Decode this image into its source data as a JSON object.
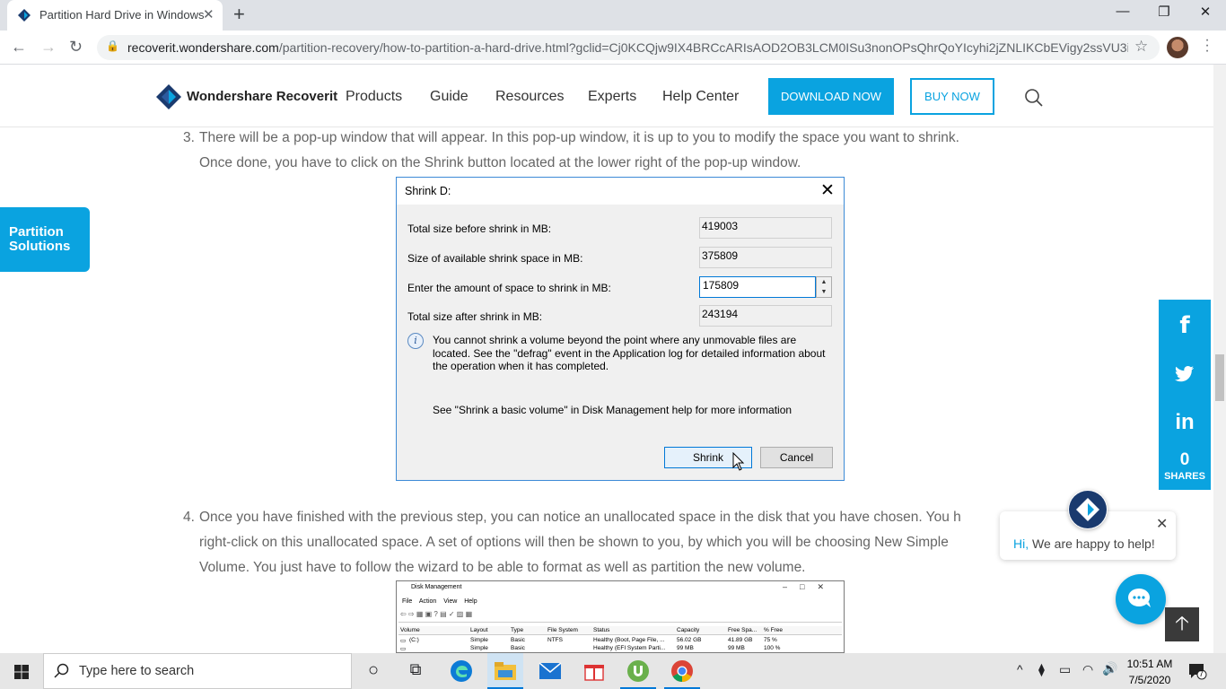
{
  "browser": {
    "tab_title": "Partition Hard Drive in Windows",
    "url_host": "recoverit.wondershare.com",
    "url_path": "/partition-recovery/how-to-partition-a-hard-drive.html?gclid=Cj0KCQjw9IX4BRCcARIsAOD2OB3LCM0ISu3nonOPsQhrQoYIcyhi2jZNLIKCbEVigy2ssVU3iI..."
  },
  "site": {
    "brand": "Wondershare Recoverit",
    "nav": [
      "Products",
      "Guide",
      "Resources",
      "Experts",
      "Help Center"
    ],
    "download_label": "DOWNLOAD NOW",
    "buy_label": "BUY NOW"
  },
  "side_tab": {
    "line1": "Partition",
    "line2": "Solutions"
  },
  "steps": [
    {
      "num": "3.",
      "line1": "There will be a pop-up window that will appear. In this pop-up window, it is up to you to modify the space you want to shrink.",
      "line2": "Once done, you have to click on the Shrink button located at the lower right of the pop-up window."
    },
    {
      "num": "4.",
      "line1": "Once you have finished with the previous step, you can notice an unallocated space in the disk that you have chosen. You h",
      "line2": "right-click on this unallocated space. A set of options will then be shown to you, by which you will be choosing New Simple",
      "line3": "Volume. You just have to follow the wizard to be able to format as well as partition the new volume."
    }
  ],
  "dialog": {
    "title": "Shrink D:",
    "total_label": "Total size before shrink in MB:",
    "total_value": "419003",
    "available_label": "Size of available shrink space in MB:",
    "available_value": "375809",
    "amount_label": "Enter the amount of space to shrink in MB:",
    "amount_value": "175809",
    "after_label": "Total size after shrink in MB:",
    "after_value": "243194",
    "info": "You cannot shrink a volume beyond the point where any unmovable files are located. See the \"defrag\" event in the Application log for detailed information about the operation when it has completed.",
    "help": "See \"Shrink a basic volume\" in Disk Management help for more information",
    "shrink_label": "Shrink",
    "cancel_label": "Cancel"
  },
  "disk_mgmt": {
    "title": "Disk Management",
    "menu": "File  Action  View  Help",
    "headers": [
      "Volume",
      "Layout",
      "Type",
      "File System",
      "Status",
      "Capacity",
      "Free Spa...",
      "% Free"
    ],
    "rows": [
      [
        "(C:)",
        "Simple",
        "Basic",
        "NTFS",
        "Healthy (Boot, Page File, ...",
        "56.02 GB",
        "41.89 GB",
        "75 %"
      ],
      [
        "",
        "Simple",
        "Basic",
        "",
        "Healthy (EFI System Parti...",
        "99 MB",
        "99 MB",
        "100 %"
      ]
    ]
  },
  "social": {
    "count": "0",
    "shares_label": "SHARES"
  },
  "chat": {
    "hi": "Hi,",
    "message": "We are happy to help!"
  },
  "taskbar": {
    "search_placeholder": "Type here to search",
    "time": "10:51 AM",
    "date": "7/5/2020",
    "notification_count": "7"
  },
  "colors": {
    "accent": "#0aa3e0",
    "dialog_border": "#3c8ad6"
  }
}
